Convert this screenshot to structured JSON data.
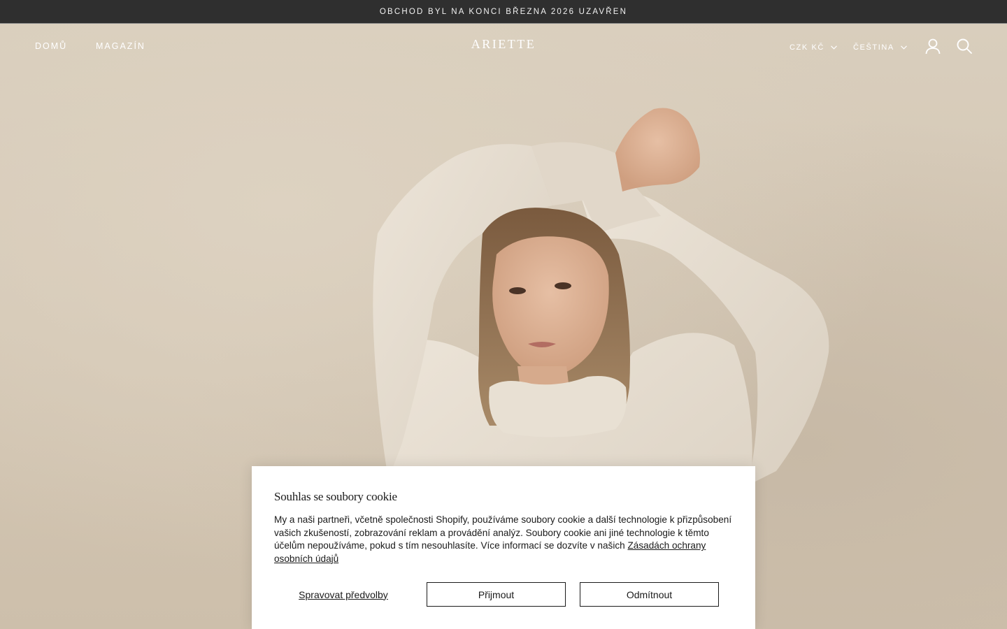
{
  "announcement": {
    "text": "OBCHOD BYL NA KONCI BŘEZNA 2026 UZAVŘEN"
  },
  "header": {
    "nav": [
      "DOMŮ",
      "MAGAZÍN"
    ],
    "logo": "ARIETTE",
    "currency": "CZK KČ",
    "language": "ČEŠTINA",
    "icons": [
      "account-icon",
      "search-icon"
    ]
  },
  "hero": {
    "image": "woman-in-cream-turtleneck-sweater-photo"
  },
  "cookie": {
    "title": "Souhlas se soubory cookie",
    "text": "My a naši partneři, včetně společnosti Shopify, používáme soubory cookie a další technologie k přizpůsobení vašich zkušeností, zobrazování reklam a provádění analýz. Soubory cookie ani jiné technologie k těmto účelům nepoužíváme, pokud s tím nesouhlasíte. Více informací se dozvíte v našich ",
    "policy_link": "Zásadách ochrany osobních údajů",
    "manage_label": "Spravovat předvolby",
    "accept_label": "Přijmout",
    "decline_label": "Odmítnout"
  },
  "colors": {
    "announcement_bg": "#2f2f2f",
    "hero_bg": "#d6cab8",
    "sweater": "#e6ddd0",
    "cookie_bg": "#ffffff",
    "text_dark": "#1a1a1a"
  }
}
